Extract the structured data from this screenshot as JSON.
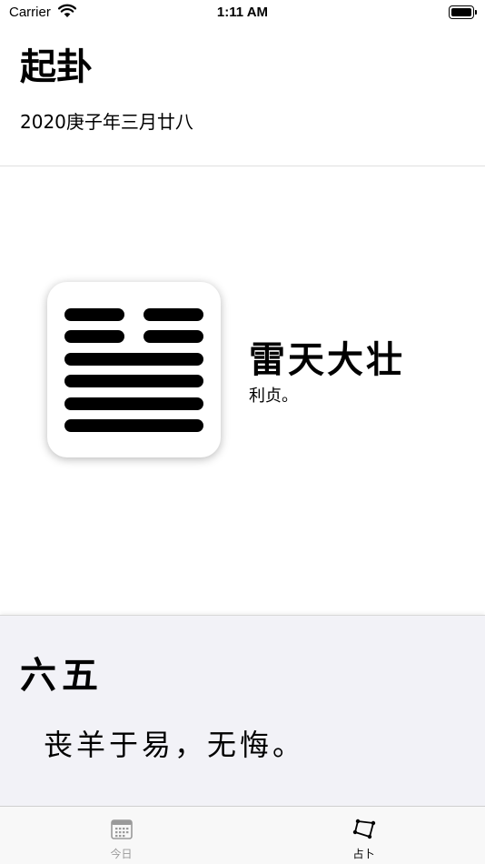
{
  "status_bar": {
    "carrier": "Carrier",
    "time": "1:11 AM"
  },
  "header": {
    "title": "起卦",
    "lunar_date": "2020庚子年三月廿八"
  },
  "hexagram": {
    "name": "雷天大壮",
    "judgment": "利贞。",
    "lines_top_to_bottom": [
      "yin",
      "yin",
      "yang",
      "yang",
      "yang",
      "yang"
    ]
  },
  "selected_line": {
    "title": "六五",
    "text": "丧羊于易，无悔。"
  },
  "tab_bar": {
    "tabs": [
      {
        "label": "今日",
        "icon": "calendar-icon",
        "selected": false
      },
      {
        "label": "占卜",
        "icon": "quadrilateral-icon",
        "selected": true
      }
    ]
  },
  "colors": {
    "panel_bg": "#f2f2f7",
    "tab_inactive": "#999999",
    "tab_active": "#000000"
  }
}
